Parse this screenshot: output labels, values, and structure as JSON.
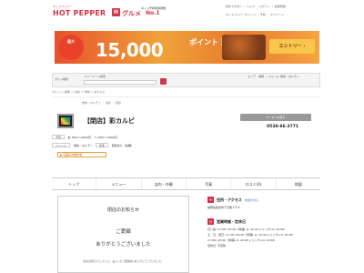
{
  "header": {
    "tagline": "ホットペッパー",
    "brand": "HOT PEPPER",
    "h_mark": "H",
    "gourmet": "グルメ",
    "no1_line": "ネット予約利用者数",
    "no1": "No.1",
    "links": "初めての方へ ｜ ヘルプ ｜ ログイン ｜ 会員登録",
    "icons": "ホットペッパーポイント ｜ 予約 ｜ マイページ"
  },
  "ad": {
    "circle": "最大",
    "number": "15,000",
    "points": "ポイント 還元",
    "entry": "エントリー ›"
  },
  "search": {
    "left_label": "グルメ検索",
    "free_label": "フリーワード検索",
    "right": "エリア　静岡 ｜ ジャンル  焼肉・ホルモン"
  },
  "breadcrumb": "グルメ ＞ 静岡 ＞ 浜松 ＞ 焼肉 ＞ 彩カルビ",
  "shop": {
    "tags": "焼肉・ホルモン ｜ 浜松 ｜ 閉店",
    "name": "【閉店】彩カルビ",
    "coupon_btn": "クーポンを見る",
    "phone": "0538-86-3771",
    "budget_label": "予算",
    "budget_dinner": "3001～4000円",
    "budget_lunch": "2001～3000円",
    "genre_label": "ジャンル",
    "genre": "焼肉・ホルモン",
    "feature_label": "特徴",
    "feature": "個室あり（禁煙）",
    "mini_button": "▶ 店舗の詳細情報",
    "colors": {
      "brand": "#d1364a",
      "accent": "#f8c64a"
    }
  },
  "tabs": [
    "トップ",
    "メニュー",
    "店内・外観",
    "写真",
    "口コミ(0)",
    "地図"
  ],
  "closed": {
    "title": "閉店のお知らせ",
    "line1": "ご愛顧",
    "line2": "ありがとうございました",
    "note": "当店は閉店いたしました。長らくのご愛顧誠にありがとうございました。"
  },
  "access": {
    "heading": "住所・アクセス",
    "link": "地図を見る",
    "address": "静岡県磐田市下万能３９４"
  },
  "hours": {
    "heading": "営業時間・定休日",
    "lines": [
      "月～金: 17:00～23:00（料理L.O. 22:00 ドリンクL.O. 22:00）",
      "土、日、祝日: 11:30～15:00（料理L.O. 14:30 ドリンクL.O. 14:30）",
      "17:00～23:00（料理L.O. 22:00 ドリンクL.O. 22:00）",
      "定休日: 不定休"
    ]
  }
}
